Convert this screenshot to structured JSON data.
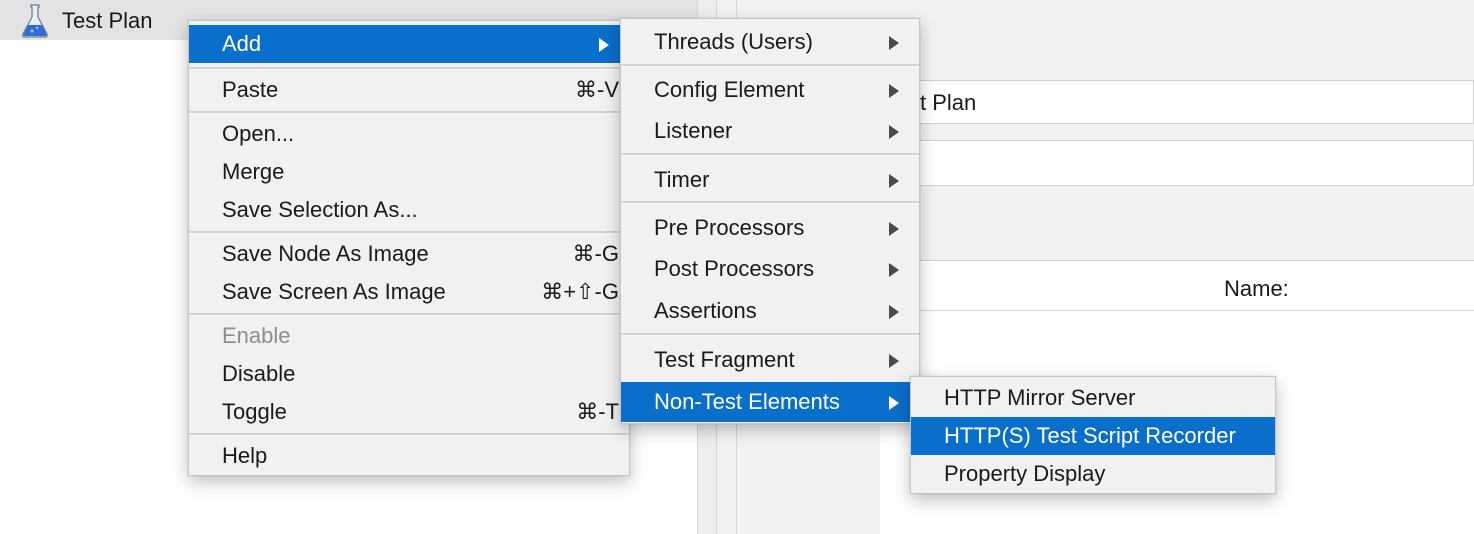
{
  "tree": {
    "root_label": "Test Plan"
  },
  "right_panel": {
    "name_value_visible": "t Plan",
    "name_column_header": "Name:"
  },
  "context_menu": {
    "items": [
      {
        "label": "Add",
        "shortcut": "",
        "submenu": true,
        "highlighted": true,
        "disabled": false
      },
      {
        "label": "Paste",
        "shortcut": "⌘-V"
      },
      {
        "label": "Open...",
        "shortcut": ""
      },
      {
        "label": "Merge",
        "shortcut": ""
      },
      {
        "label": "Save Selection As...",
        "shortcut": ""
      },
      {
        "label": "Save Node As Image",
        "shortcut": "⌘-G"
      },
      {
        "label": "Save Screen As Image",
        "shortcut": "⌘+⇧-G"
      },
      {
        "label": "Enable",
        "shortcut": "",
        "disabled": true
      },
      {
        "label": "Disable",
        "shortcut": ""
      },
      {
        "label": "Toggle",
        "shortcut": "⌘-T"
      },
      {
        "label": "Help",
        "shortcut": ""
      }
    ]
  },
  "add_submenu": {
    "items": [
      {
        "label": "Threads (Users)"
      },
      {
        "label": "Config Element"
      },
      {
        "label": "Listener"
      },
      {
        "label": "Timer"
      },
      {
        "label": "Pre Processors"
      },
      {
        "label": "Post Processors"
      },
      {
        "label": "Assertions"
      },
      {
        "label": "Test Fragment"
      },
      {
        "label": "Non-Test Elements",
        "highlighted": true
      }
    ]
  },
  "non_test_submenu": {
    "items": [
      {
        "label": "HTTP Mirror Server"
      },
      {
        "label": "HTTP(S) Test Script Recorder",
        "highlighted": true
      },
      {
        "label": "Property Display"
      }
    ]
  },
  "colors": {
    "highlight": "#0a6fca",
    "menu_bg": "#f1f1f1",
    "tree_selection": "#e3e3e3"
  },
  "icons": {
    "tree_root": "flask-icon",
    "submenu_arrow": "triangle-right-icon"
  }
}
